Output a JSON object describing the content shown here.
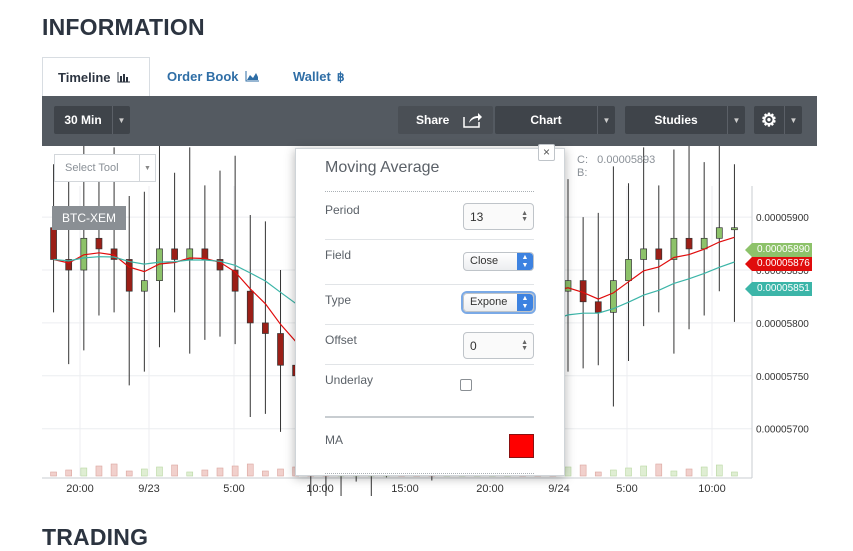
{
  "info_title": "INFORMATION",
  "trading_title": "TRADING",
  "tabs": [
    {
      "label": "Timeline",
      "icon": "bar-chart-icon"
    },
    {
      "label": "Order Book",
      "icon": "area-chart-icon"
    },
    {
      "label": "Wallet",
      "icon": "bitcoin-icon"
    }
  ],
  "toolbar": {
    "interval": "30 Min",
    "share": "Share",
    "chart": "Chart",
    "studies": "Studies"
  },
  "select_tool": "Select Tool",
  "symbol": "BTC-XEM",
  "readout": {
    "c_label": "C:",
    "c_value": "0.00005893",
    "b_label": "B:"
  },
  "modal": {
    "title": "Moving Average",
    "close": "×",
    "period_label": "Period",
    "period_value": "13",
    "field_label": "Field",
    "field_value": "Close",
    "type_label": "Type",
    "type_value": "Expone",
    "offset_label": "Offset",
    "offset_value": "0",
    "underlay_label": "Underlay",
    "underlay_checked": false,
    "ma_label": "MA",
    "ma_color": "#ff0000"
  },
  "price_labels": {
    "green": "0.00005890",
    "red": "0.00005876",
    "teal": "0.00005851"
  },
  "colors": {
    "up": "#8dc26a",
    "down": "#9b1f17",
    "ma_red": "#e00c0c",
    "ma_teal": "#3cb5a8"
  },
  "chart_data": {
    "type": "candlestick",
    "y_ticks": [
      "0.00005900",
      "0.00005850",
      "0.00005800",
      "0.00005750",
      "0.00005700"
    ],
    "x_ticks": [
      "20:00",
      "9/23",
      "5:00",
      "10:00",
      "15:00",
      "20:00",
      "9/24",
      "5:00",
      "10:00"
    ],
    "ylim": [
      5.66e-05,
      5.92e-05
    ],
    "closes": [
      5.86e-05,
      5.85e-05,
      5.88e-05,
      5.87e-05,
      5.86e-05,
      5.83e-05,
      5.84e-05,
      5.87e-05,
      5.86e-05,
      5.87e-05,
      5.86e-05,
      5.85e-05,
      5.83e-05,
      5.8e-05,
      5.79e-05,
      5.76e-05,
      5.75e-05,
      5.71e-05,
      5.69e-05,
      5.7e-05,
      5.7e-05,
      5.73e-05,
      5.77e-05,
      5.76e-05,
      5.75e-05,
      5.74e-05,
      5.75e-05,
      5.76e-05,
      5.77e-05,
      5.85e-05,
      5.86e-05,
      5.85e-05,
      5.84e-05,
      5.83e-05,
      5.84e-05,
      5.82e-05,
      5.81e-05,
      5.84e-05,
      5.86e-05,
      5.87e-05,
      5.86e-05,
      5.88e-05,
      5.87e-05,
      5.88e-05,
      5.89e-05,
      5.89e-05
    ]
  }
}
